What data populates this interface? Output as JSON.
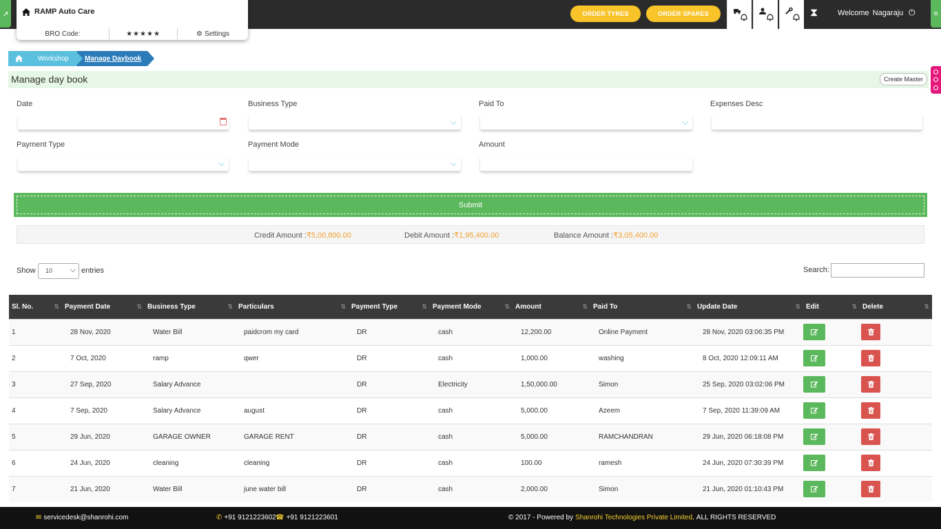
{
  "brand": {
    "name": "RAMP Auto Care",
    "bro_code_label": "BRO Code:",
    "stars": "★★★★★",
    "settings_label": "Settings"
  },
  "header": {
    "order_tyres": "ORDER TYRES",
    "order_spares": "ORDER SPARES",
    "welcome": "Welcome",
    "username": "Nagaraju"
  },
  "breadcrumb": {
    "workshop": "Workshop",
    "current": "Manage Daybook"
  },
  "page": {
    "title": "Manage day book",
    "create_master": "Create Master"
  },
  "form": {
    "date_label": "Date",
    "business_type_label": "Business Type",
    "paid_to_label": "Paid To",
    "expenses_desc_label": "Expenses Desc",
    "payment_type_label": "Payment Type",
    "payment_mode_label": "Payment Mode",
    "amount_label": "Amount",
    "submit_label": "Submit"
  },
  "summary": {
    "credit_label": "Credit Amount :",
    "credit_value": "₹5,00,800.00",
    "debit_label": "Debit Amount :",
    "debit_value": "₹1,95,400.00",
    "balance_label": "Balance Amount :",
    "balance_value": "₹3,05,400.00"
  },
  "table_controls": {
    "show_label": "Show",
    "entries_value": "10",
    "entries_label": "entries",
    "search_label": "Search:"
  },
  "table": {
    "headers": [
      "Sl. No.",
      "Payment Date",
      "Business Type",
      "Particulars",
      "Payment Type",
      "Payment Mode",
      "Amount",
      "Paid To",
      "Update Date",
      "Edit",
      "Delete"
    ],
    "rows": [
      [
        "1",
        "28 Nov, 2020",
        "Water Bill",
        "paidcrom my card",
        "DR",
        "cash",
        "12,200.00",
        "Online Payment",
        "28 Nov, 2020 03:06:35 PM"
      ],
      [
        "2",
        "7 Oct, 2020",
        "ramp",
        "qwer",
        "DR",
        "cash",
        "1,000.00",
        "washing",
        "8 Oct, 2020 12:09:11 AM"
      ],
      [
        "3",
        "27 Sep, 2020",
        "Salary Advance",
        "",
        "DR",
        "Electricity",
        "1,50,000.00",
        "Simon",
        "25 Sep, 2020 03:02:06 PM"
      ],
      [
        "4",
        "7 Sep, 2020",
        "Salary Advance",
        "august",
        "DR",
        "cash",
        "5,000.00",
        "Azeem",
        "7 Sep, 2020 11:39:09 AM"
      ],
      [
        "5",
        "29 Jun, 2020",
        "GARAGE OWNER",
        "GARAGE RENT",
        "DR",
        "cash",
        "5,000.00",
        "RAMCHANDRAN",
        "29 Jun, 2020 06:18:08 PM"
      ],
      [
        "6",
        "24 Jun, 2020",
        "cleaning",
        "cleaning",
        "DR",
        "cash",
        "100.00",
        "ramesh",
        "24 Jun, 2020 07:30:39 PM"
      ],
      [
        "7",
        "21 Jun, 2020",
        "Water Bill",
        "june water bill",
        "DR",
        "cash",
        "2,000.00",
        "Simon",
        "21 Jun, 2020 01:10:43 PM"
      ]
    ]
  },
  "footer": {
    "email": "servicedesk@shanrohi.com",
    "whatsapp": "+91 9121223602",
    "phone": "+91 9121223601",
    "copyright_prefix": "© 2017 - Powered by",
    "company": "Shanrohi Technologies Private Limited,",
    "rights": "ALL RIGHTS RESERVED"
  },
  "colors": {
    "accent_green": "#5cb85c",
    "order_yellow": "#f8c42a",
    "delete_red": "#d9534f",
    "amount_orange": "#f0a030"
  }
}
